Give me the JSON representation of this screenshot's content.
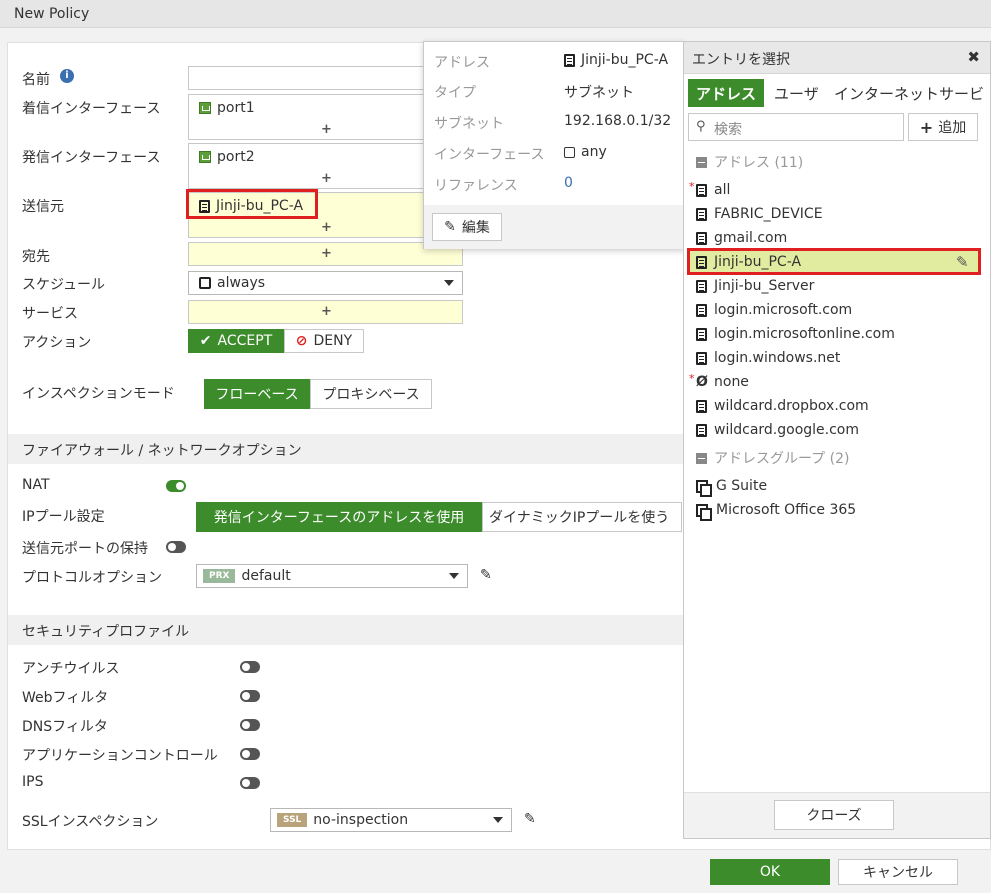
{
  "window": {
    "title": "New Policy"
  },
  "form": {
    "name_label": "名前",
    "incoming_label": "着信インターフェース",
    "incoming_value": "port1",
    "outgoing_label": "発信インターフェース",
    "outgoing_value": "port2",
    "source_label": "送信元",
    "source_value": "Jinji-bu_PC-A",
    "dest_label": "宛先",
    "schedule_label": "スケジュール",
    "schedule_value": "always",
    "service_label": "サービス",
    "action_label": "アクション",
    "accept_label": "ACCEPT",
    "deny_label": "DENY",
    "inspection_label": "インスペクションモード",
    "flow_label": "フローベース",
    "proxy_label": "プロキシベース",
    "plus": "+"
  },
  "firewall": {
    "section_title": "ファイアウォール / ネットワークオプション",
    "nat_label": "NAT",
    "nat_on": true,
    "ippool_label": "IPプール設定",
    "ippool_opt1": "発信インターフェースのアドレスを使用",
    "ippool_opt2": "ダイナミックIPプールを使う",
    "preserve_label": "送信元ポートの保持",
    "protocol_label": "プロトコルオプション",
    "protocol_badge": "PRX",
    "protocol_value": "default"
  },
  "security": {
    "section_title": "セキュリティプロファイル",
    "items": [
      "アンチウイルス",
      "Webフィルタ",
      "DNSフィルタ",
      "アプリケーションコントロール",
      "IPS"
    ],
    "ssl_label": "SSLインスペクション",
    "ssl_badge": "SSL",
    "ssl_value": "no-inspection"
  },
  "popup": {
    "address_key": "アドレス",
    "address_val": "Jinji-bu_PC-A",
    "type_key": "タイプ",
    "type_val": "サブネット",
    "subnet_key": "サブネット",
    "subnet_val": "192.168.0.1/32",
    "iface_key": "インターフェース",
    "iface_val": "any",
    "ref_key": "リファレンス",
    "ref_val": "0",
    "edit_label": "編集"
  },
  "panel": {
    "title": "エントリを選択",
    "close_icon": "✖",
    "tabs": [
      "アドレス",
      "ユーザ",
      "インターネットサービ"
    ],
    "search_placeholder": "検索",
    "add_label": "追加",
    "group1": "アドレス (11)",
    "addresses": [
      "all",
      "FABRIC_DEVICE",
      "gmail.com",
      "Jinji-bu_PC-A",
      "Jinji-bu_Server",
      "login.microsoft.com",
      "login.microsoftonline.com",
      "login.windows.net",
      "none",
      "wildcard.dropbox.com",
      "wildcard.google.com"
    ],
    "group2": "アドレスグループ (2)",
    "groups": [
      "G Suite",
      "Microsoft Office 365"
    ],
    "close_label": "クローズ"
  },
  "footer": {
    "ok_label": "OK",
    "cancel_label": "キャンセル"
  },
  "colors": {
    "accent": "#3d8c2c",
    "highlight": "#e02020",
    "selected_row": "#e2eca0"
  }
}
